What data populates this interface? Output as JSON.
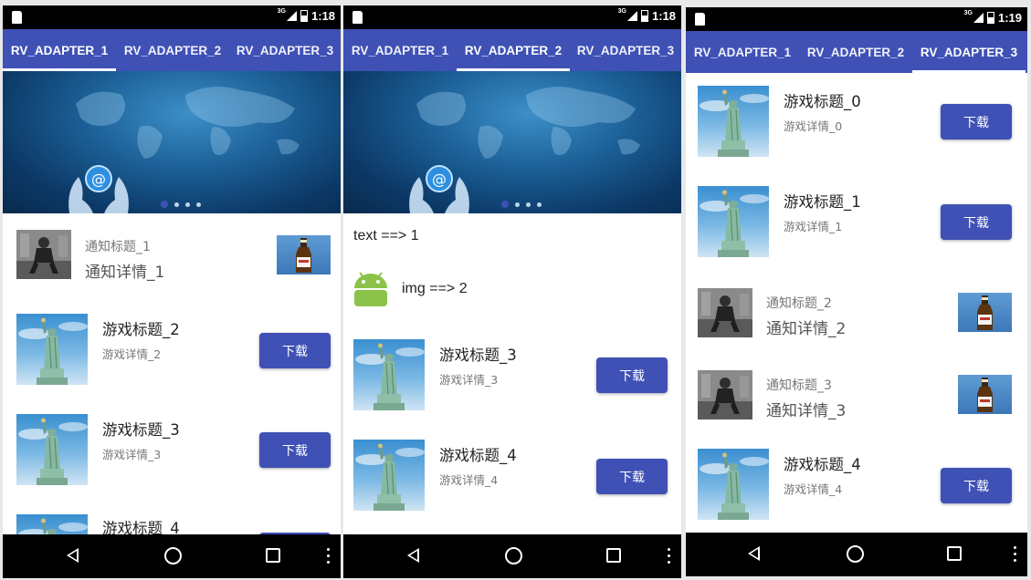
{
  "status": {
    "screen1_time": "1:18",
    "screen2_time": "1:18",
    "screen3_time": "1:19",
    "network": "3G"
  },
  "tabs": [
    "RV_ADAPTER_1",
    "RV_ADAPTER_2",
    "RV_ADAPTER_3"
  ],
  "screen1": {
    "active_tab": 0,
    "notice": {
      "title": "通知标题_1",
      "detail": "通知详情_1"
    },
    "games": [
      {
        "title": "游戏标题_2",
        "desc": "游戏详情_2",
        "button": "下载"
      },
      {
        "title": "游戏标题_3",
        "desc": "游戏详情_3",
        "button": "下载"
      },
      {
        "title": "游戏标题_4",
        "desc": "",
        "button": ""
      }
    ]
  },
  "screen2": {
    "active_tab": 1,
    "text_item": "text ==> 1",
    "img_item": "img ==> 2",
    "games": [
      {
        "title": "游戏标题_3",
        "desc": "游戏详情_3",
        "button": "下载"
      },
      {
        "title": "游戏标题_4",
        "desc": "游戏详情_4",
        "button": "下载"
      }
    ]
  },
  "screen3": {
    "active_tab": 2,
    "games_top": [
      {
        "title": "游戏标题_0",
        "desc": "游戏详情_0",
        "button": "下载"
      },
      {
        "title": "游戏标题_1",
        "desc": "游戏详情_1",
        "button": "下载"
      }
    ],
    "notices": [
      {
        "title": "通知标题_2",
        "detail": "通知详情_2"
      },
      {
        "title": "通知标题_3",
        "detail": "通知详情_3"
      }
    ],
    "game_bottom": {
      "title": "游戏标题_4",
      "desc": "游戏详情_4",
      "button": "下载"
    }
  },
  "banner": {
    "dots": 4,
    "active_dot": 0
  },
  "colors": {
    "primary": "#3f51b5",
    "status_bar": "#000000",
    "nav_bar": "#000000"
  }
}
